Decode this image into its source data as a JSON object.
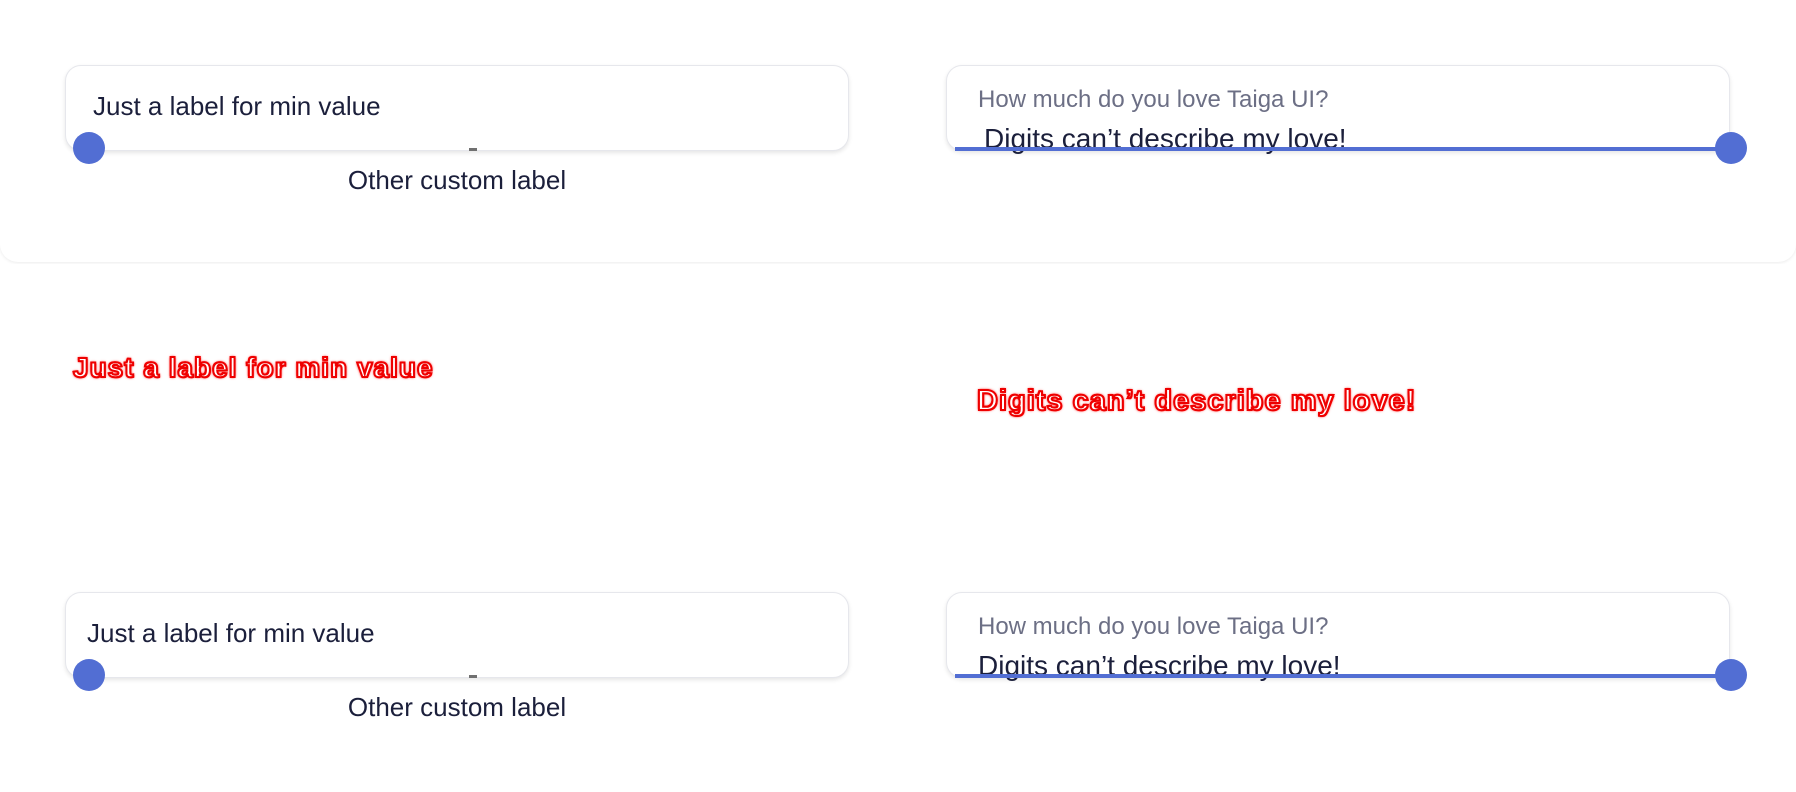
{
  "top": {
    "left_field": {
      "label": "Just a label for min value",
      "under_label": "Other custom label",
      "value_fraction": 0
    },
    "right_field": {
      "label": "How much do you love Taiga UI?",
      "value_text": "Digits can’t describe my love!",
      "value_fraction": 1
    }
  },
  "diff": {
    "left_text": "Just a label for min value",
    "right_text": "Digits can’t describe my love!"
  },
  "bottom": {
    "left_field": {
      "label": "Just a label for min value",
      "under_label": "Other custom label",
      "value_fraction": 0
    },
    "right_field": {
      "label": "How much do you love Taiga UI?",
      "value_text": "Digits can’t describe my love!",
      "value_fraction": 1
    }
  },
  "colors": {
    "accent": "#526ed3",
    "diff_red": "#ee0000",
    "text": "#1b1f3b",
    "muted_text": "#6c6f85"
  }
}
